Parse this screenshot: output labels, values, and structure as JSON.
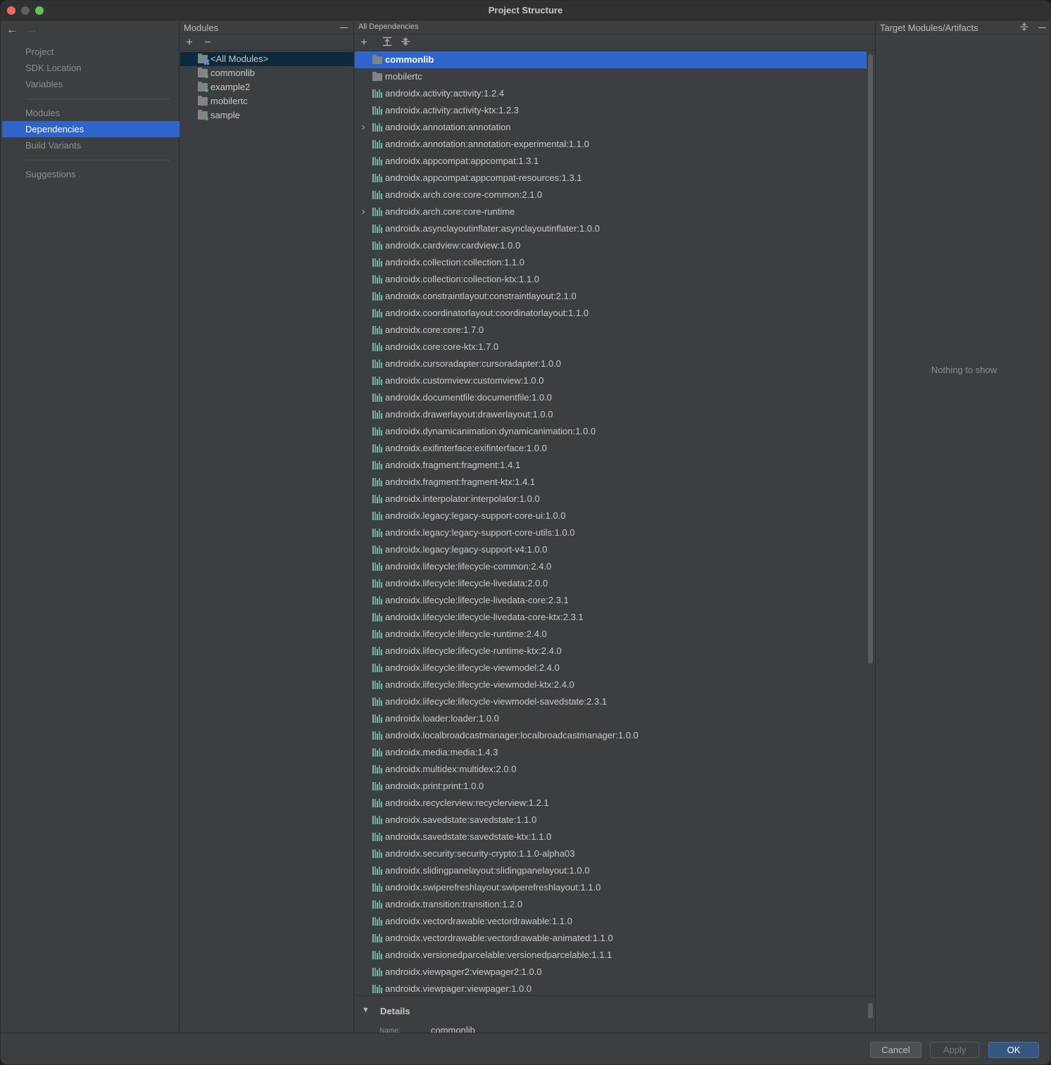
{
  "window": {
    "title": "Project Structure"
  },
  "nav": {
    "items": [
      {
        "label": "Project"
      },
      {
        "label": "SDK Location"
      },
      {
        "label": "Variables"
      },
      {
        "label": "Modules"
      },
      {
        "label": "Dependencies",
        "active": true
      },
      {
        "label": "Build Variants"
      },
      {
        "label": "Suggestions"
      }
    ]
  },
  "modules": {
    "header": "Modules",
    "items": [
      {
        "label": "<All Modules>",
        "selected": true,
        "type": "all"
      },
      {
        "label": "commonlib",
        "type": "module"
      },
      {
        "label": "example2",
        "type": "module"
      },
      {
        "label": "mobilertc",
        "type": "folder"
      },
      {
        "label": "sample",
        "type": "module"
      }
    ]
  },
  "deps": {
    "header": "All Dependencies",
    "items": [
      {
        "label": "commonlib",
        "type": "module",
        "selected": true
      },
      {
        "label": "mobilertc",
        "type": "module"
      },
      {
        "label": "androidx.activity:activity:1.2.4"
      },
      {
        "label": "androidx.activity:activity-ktx:1.2.3"
      },
      {
        "label": "androidx.annotation:annotation",
        "expandable": true
      },
      {
        "label": "androidx.annotation:annotation-experimental:1.1.0"
      },
      {
        "label": "androidx.appcompat:appcompat:1.3.1"
      },
      {
        "label": "androidx.appcompat:appcompat-resources:1.3.1"
      },
      {
        "label": "androidx.arch.core:core-common:2.1.0"
      },
      {
        "label": "androidx.arch.core:core-runtime",
        "expandable": true
      },
      {
        "label": "androidx.asynclayoutinflater:asynclayoutinflater:1.0.0"
      },
      {
        "label": "androidx.cardview:cardview:1.0.0"
      },
      {
        "label": "androidx.collection:collection:1.1.0"
      },
      {
        "label": "androidx.collection:collection-ktx:1.1.0"
      },
      {
        "label": "androidx.constraintlayout:constraintlayout:2.1.0"
      },
      {
        "label": "androidx.coordinatorlayout:coordinatorlayout:1.1.0"
      },
      {
        "label": "androidx.core:core:1.7.0"
      },
      {
        "label": "androidx.core:core-ktx:1.7.0"
      },
      {
        "label": "androidx.cursoradapter:cursoradapter:1.0.0"
      },
      {
        "label": "androidx.customview:customview:1.0.0"
      },
      {
        "label": "androidx.documentfile:documentfile:1.0.0"
      },
      {
        "label": "androidx.drawerlayout:drawerlayout:1.0.0"
      },
      {
        "label": "androidx.dynamicanimation:dynamicanimation:1.0.0"
      },
      {
        "label": "androidx.exifinterface:exifinterface:1.0.0"
      },
      {
        "label": "androidx.fragment:fragment:1.4.1"
      },
      {
        "label": "androidx.fragment:fragment-ktx:1.4.1"
      },
      {
        "label": "androidx.interpolator:interpolator:1.0.0"
      },
      {
        "label": "androidx.legacy:legacy-support-core-ui:1.0.0"
      },
      {
        "label": "androidx.legacy:legacy-support-core-utils:1.0.0"
      },
      {
        "label": "androidx.legacy:legacy-support-v4:1.0.0"
      },
      {
        "label": "androidx.lifecycle:lifecycle-common:2.4.0"
      },
      {
        "label": "androidx.lifecycle:lifecycle-livedata:2.0.0"
      },
      {
        "label": "androidx.lifecycle:lifecycle-livedata-core:2.3.1"
      },
      {
        "label": "androidx.lifecycle:lifecycle-livedata-core-ktx:2.3.1"
      },
      {
        "label": "androidx.lifecycle:lifecycle-runtime:2.4.0"
      },
      {
        "label": "androidx.lifecycle:lifecycle-runtime-ktx:2.4.0"
      },
      {
        "label": "androidx.lifecycle:lifecycle-viewmodel:2.4.0"
      },
      {
        "label": "androidx.lifecycle:lifecycle-viewmodel-ktx:2.4.0"
      },
      {
        "label": "androidx.lifecycle:lifecycle-viewmodel-savedstate:2.3.1"
      },
      {
        "label": "androidx.loader:loader:1.0.0"
      },
      {
        "label": "androidx.localbroadcastmanager:localbroadcastmanager:1.0.0"
      },
      {
        "label": "androidx.media:media:1.4.3"
      },
      {
        "label": "androidx.multidex:multidex:2.0.0"
      },
      {
        "label": "androidx.print:print:1.0.0"
      },
      {
        "label": "androidx.recyclerview:recyclerview:1.2.1"
      },
      {
        "label": "androidx.savedstate:savedstate:1.1.0"
      },
      {
        "label": "androidx.savedstate:savedstate-ktx:1.1.0"
      },
      {
        "label": "androidx.security:security-crypto:1.1.0-alpha03"
      },
      {
        "label": "androidx.slidingpanelayout:slidingpanelayout:1.0.0"
      },
      {
        "label": "androidx.swiperefreshlayout:swiperefreshlayout:1.1.0"
      },
      {
        "label": "androidx.transition:transition:1.2.0"
      },
      {
        "label": "androidx.vectordrawable:vectordrawable:1.1.0"
      },
      {
        "label": "androidx.vectordrawable:vectordrawable-animated:1.1.0"
      },
      {
        "label": "androidx.versionedparcelable:versionedparcelable:1.1.1"
      },
      {
        "label": "androidx.viewpager2:viewpager2:1.0.0"
      },
      {
        "label": "androidx.viewpager:viewpager:1.0.0"
      }
    ],
    "details": {
      "heading": "Details",
      "name_label": "Name:",
      "name_value": "commonlib"
    }
  },
  "target": {
    "header": "Target Modules/Artifacts",
    "empty_text": "Nothing to show"
  },
  "buttons": {
    "cancel": "Cancel",
    "apply": "Apply",
    "ok": "OK"
  },
  "colors": {
    "selection": "#2f65ca",
    "panel_bg": "#3c3f41",
    "ok_button": "#365880"
  }
}
